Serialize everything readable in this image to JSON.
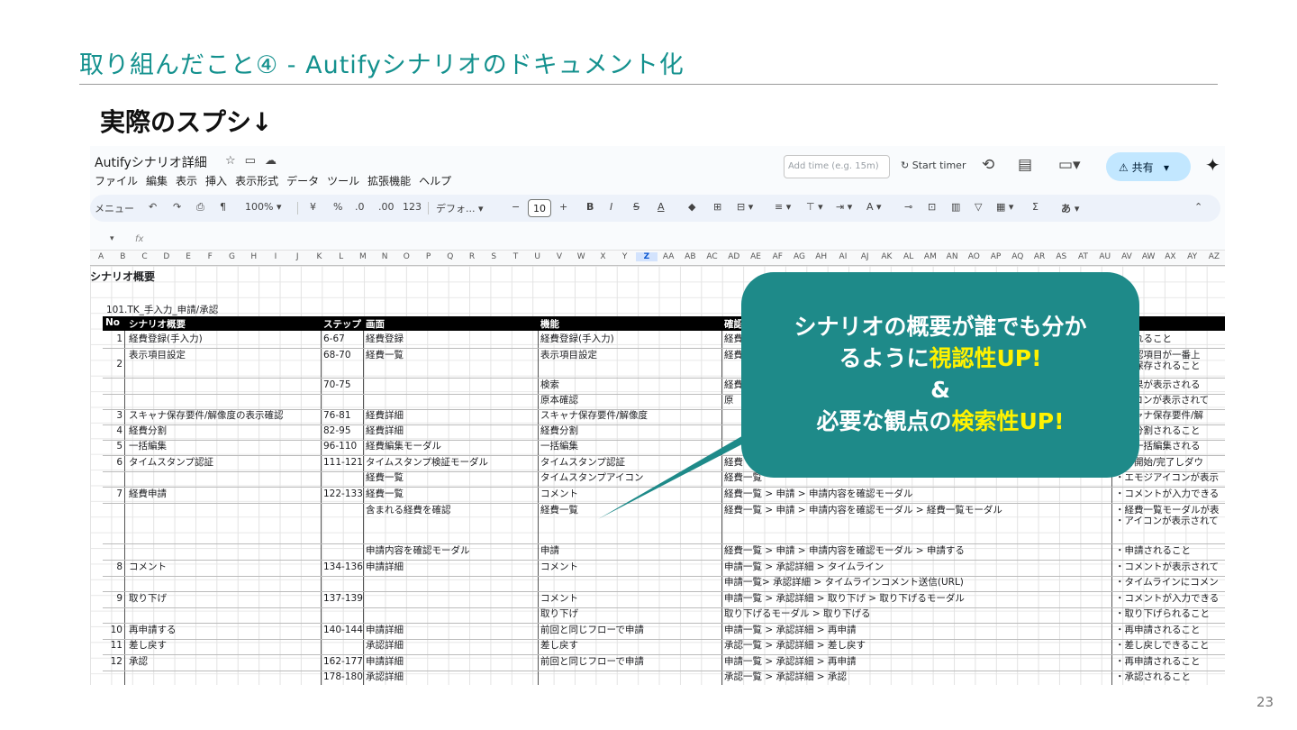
{
  "slide": {
    "title": "取り組んだこと④ - Autifyシナリオのドキュメント化",
    "subtitle": "実際のスプシ↓",
    "page_number": "23"
  },
  "callout": {
    "line1": "シナリオの概要が誰でも分か",
    "line2_pre": "るように",
    "line2_hl": "視認性UP!",
    "line3": "&",
    "line4_pre": "必要な観点の",
    "line4_hl": "検索性UP!",
    "bg_color": "#1e8a89",
    "highlight_color": "#fff200"
  },
  "sheet": {
    "doc_title": "Autifyシナリオ詳細",
    "menu": [
      "ファイル",
      "編集",
      "表示",
      "挿入",
      "表示形式",
      "データ",
      "ツール",
      "拡張機能",
      "ヘルプ"
    ],
    "add_time_placeholder": "Add time (e.g. 15m)",
    "start_timer": "Start timer",
    "share_label": "共有",
    "toolbar": {
      "menu_search": "メニュー",
      "zoom": "100%",
      "currency": "¥",
      "percent": "%",
      "dec_decrease": ".0",
      "dec_increase": ".00",
      "number_format": "123",
      "font": "デフォ...",
      "font_size": "10",
      "input_method": "あ"
    },
    "formula_bar": {
      "fx": "fx"
    },
    "columns": [
      "A",
      "B",
      "C",
      "D",
      "E",
      "F",
      "G",
      "H",
      "I",
      "J",
      "K",
      "L",
      "M",
      "N",
      "O",
      "P",
      "Q",
      "R",
      "S",
      "T",
      "U",
      "V",
      "W",
      "X",
      "Y",
      "Z",
      "AA",
      "AB",
      "AC",
      "AD",
      "AE",
      "AF",
      "AG",
      "AH",
      "AI",
      "AJ",
      "AK",
      "AL",
      "AM",
      "AN",
      "AO",
      "AP",
      "AQ",
      "AR",
      "AS",
      "AT",
      "AU",
      "AV",
      "AW",
      "AX",
      "AY",
      "AZ"
    ],
    "active_column": "Z",
    "heading": "シナリオ概要",
    "section_label": "101.TK_手入力_申請/承認",
    "headers": {
      "no": "No",
      "scenario": "シナリオ概要",
      "step": "ステップ",
      "screen": "画面",
      "function": "機能",
      "confirm": "確認"
    },
    "rows": [
      {
        "no": "1",
        "scenario": "経費登録(手入力)",
        "step": "6-67",
        "screen": "経費登録",
        "function": "経費登録(手入力)",
        "path": "経費",
        "result": "録されること"
      },
      {
        "no": "2",
        "scenario": "表示項目設定",
        "step": "68-70",
        "screen": "経費一覧",
        "function": "表示項目設定",
        "path": "経費",
        "result": "本確認項目が一番上",
        "result2": "定が保存されること"
      },
      {
        "no": "",
        "scenario": "",
        "step": "70-75",
        "screen": "",
        "function": "検索",
        "path": "経費",
        "result": "索結果が表示される"
      },
      {
        "no": "",
        "scenario": "",
        "step": "",
        "screen": "",
        "function": "原本確認",
        "path": "原",
        "result": "アイコンが表示されて"
      },
      {
        "no": "3",
        "scenario": "スキャナ保存要件/解像度の表示確認",
        "step": "76-81",
        "screen": "経費詳細",
        "function": "スキャナ保存要件/解像度",
        "path": "",
        "result": "スキャナ保存要件/解"
      },
      {
        "no": "4",
        "scenario": "経費分割",
        "step": "82-95",
        "screen": "経費詳細",
        "function": "経費分割",
        "path": "",
        "result": "費が分割されること"
      },
      {
        "no": "5",
        "scenario": "一括編集",
        "step": "96-110",
        "screen": "経費編集モーダル",
        "function": "一括編集",
        "path": "",
        "result": "費が一括編集される"
      },
      {
        "no": "6",
        "scenario": "タイムスタンプ認証",
        "step": "111-121",
        "screen": "タイムスタンプ検証モーダル",
        "function": "タイムスタンプ認証",
        "path": "経費",
        "result": "証を開始/完了しダウ"
      },
      {
        "no": "",
        "scenario": "",
        "step": "",
        "screen": "経費一覧",
        "function": "タイムスタンプアイコン",
        "path": "経費一覧",
        "result": "・エモジアイコンが表示"
      },
      {
        "no": "7",
        "scenario": "経費申請",
        "step": "122-133",
        "screen": "経費一覧",
        "function": "コメント",
        "path": "経費一覧 > 申請 > 申請内容を確認モーダル",
        "result": "・コメントが入力できる"
      },
      {
        "no": "",
        "scenario": "",
        "step": "",
        "screen": "含まれる経費を確認",
        "function": "経費一覧",
        "path": "経費一覧 > 申請 > 申請内容を確認モーダル > 経費一覧モーダル",
        "result": "・経費一覧モーダルが表",
        "result2": "・アイコンが表示されて"
      },
      {
        "no": "",
        "scenario": "",
        "step": "",
        "screen": "申請内容を確認モーダル",
        "function": "申請",
        "path": "経費一覧 > 申請 > 申請内容を確認モーダル > 申請する",
        "result": "・申請されること"
      },
      {
        "no": "8",
        "scenario": "コメント",
        "step": "134-136",
        "screen": "申請詳細",
        "function": "コメント",
        "path": "申請一覧 > 承認詳細 > タイムライン",
        "result": "・コメントが表示されて"
      },
      {
        "no": "",
        "scenario": "",
        "step": "",
        "screen": "",
        "function": "",
        "path": "申請一覧> 承認詳細 > タイムラインコメント送信(URL)",
        "result": "・タイムラインにコメン"
      },
      {
        "no": "9",
        "scenario": "取り下げ",
        "step": "137-139",
        "screen": "",
        "function": "コメント",
        "path": "申請一覧 > 承認詳細 > 取り下げ > 取り下げるモーダル",
        "result": "・コメントが入力できる"
      },
      {
        "no": "",
        "scenario": "",
        "step": "",
        "screen": "",
        "function": "取り下げ",
        "path": "取り下げるモーダル > 取り下げる",
        "result": "・取り下げられること"
      },
      {
        "no": "10",
        "scenario": "再申請する",
        "step": "140-144",
        "screen": "申請詳細",
        "function": "前回と同じフローで申請",
        "path": "申請一覧 > 承認詳細 > 再申請",
        "result": "・再申請されること"
      },
      {
        "no": "11",
        "scenario": "差し戻す",
        "step": "",
        "screen": "承認詳細",
        "function": "差し戻す",
        "path": "承認一覧 > 承認詳細 > 差し戻す",
        "result": "・差し戻しできること"
      },
      {
        "no": "12",
        "scenario": "承認",
        "step": "162-177",
        "screen": "申請詳細",
        "function": "前回と同じフローで申請",
        "path": "申請一覧 > 承認詳細 > 再申請",
        "result": "・再申請されること"
      },
      {
        "no": "",
        "scenario": "",
        "step": "178-180",
        "screen": "承認詳細",
        "function": "",
        "path": "承認一覧 > 承認詳細 > 承認",
        "result": "・承認されること"
      }
    ]
  }
}
